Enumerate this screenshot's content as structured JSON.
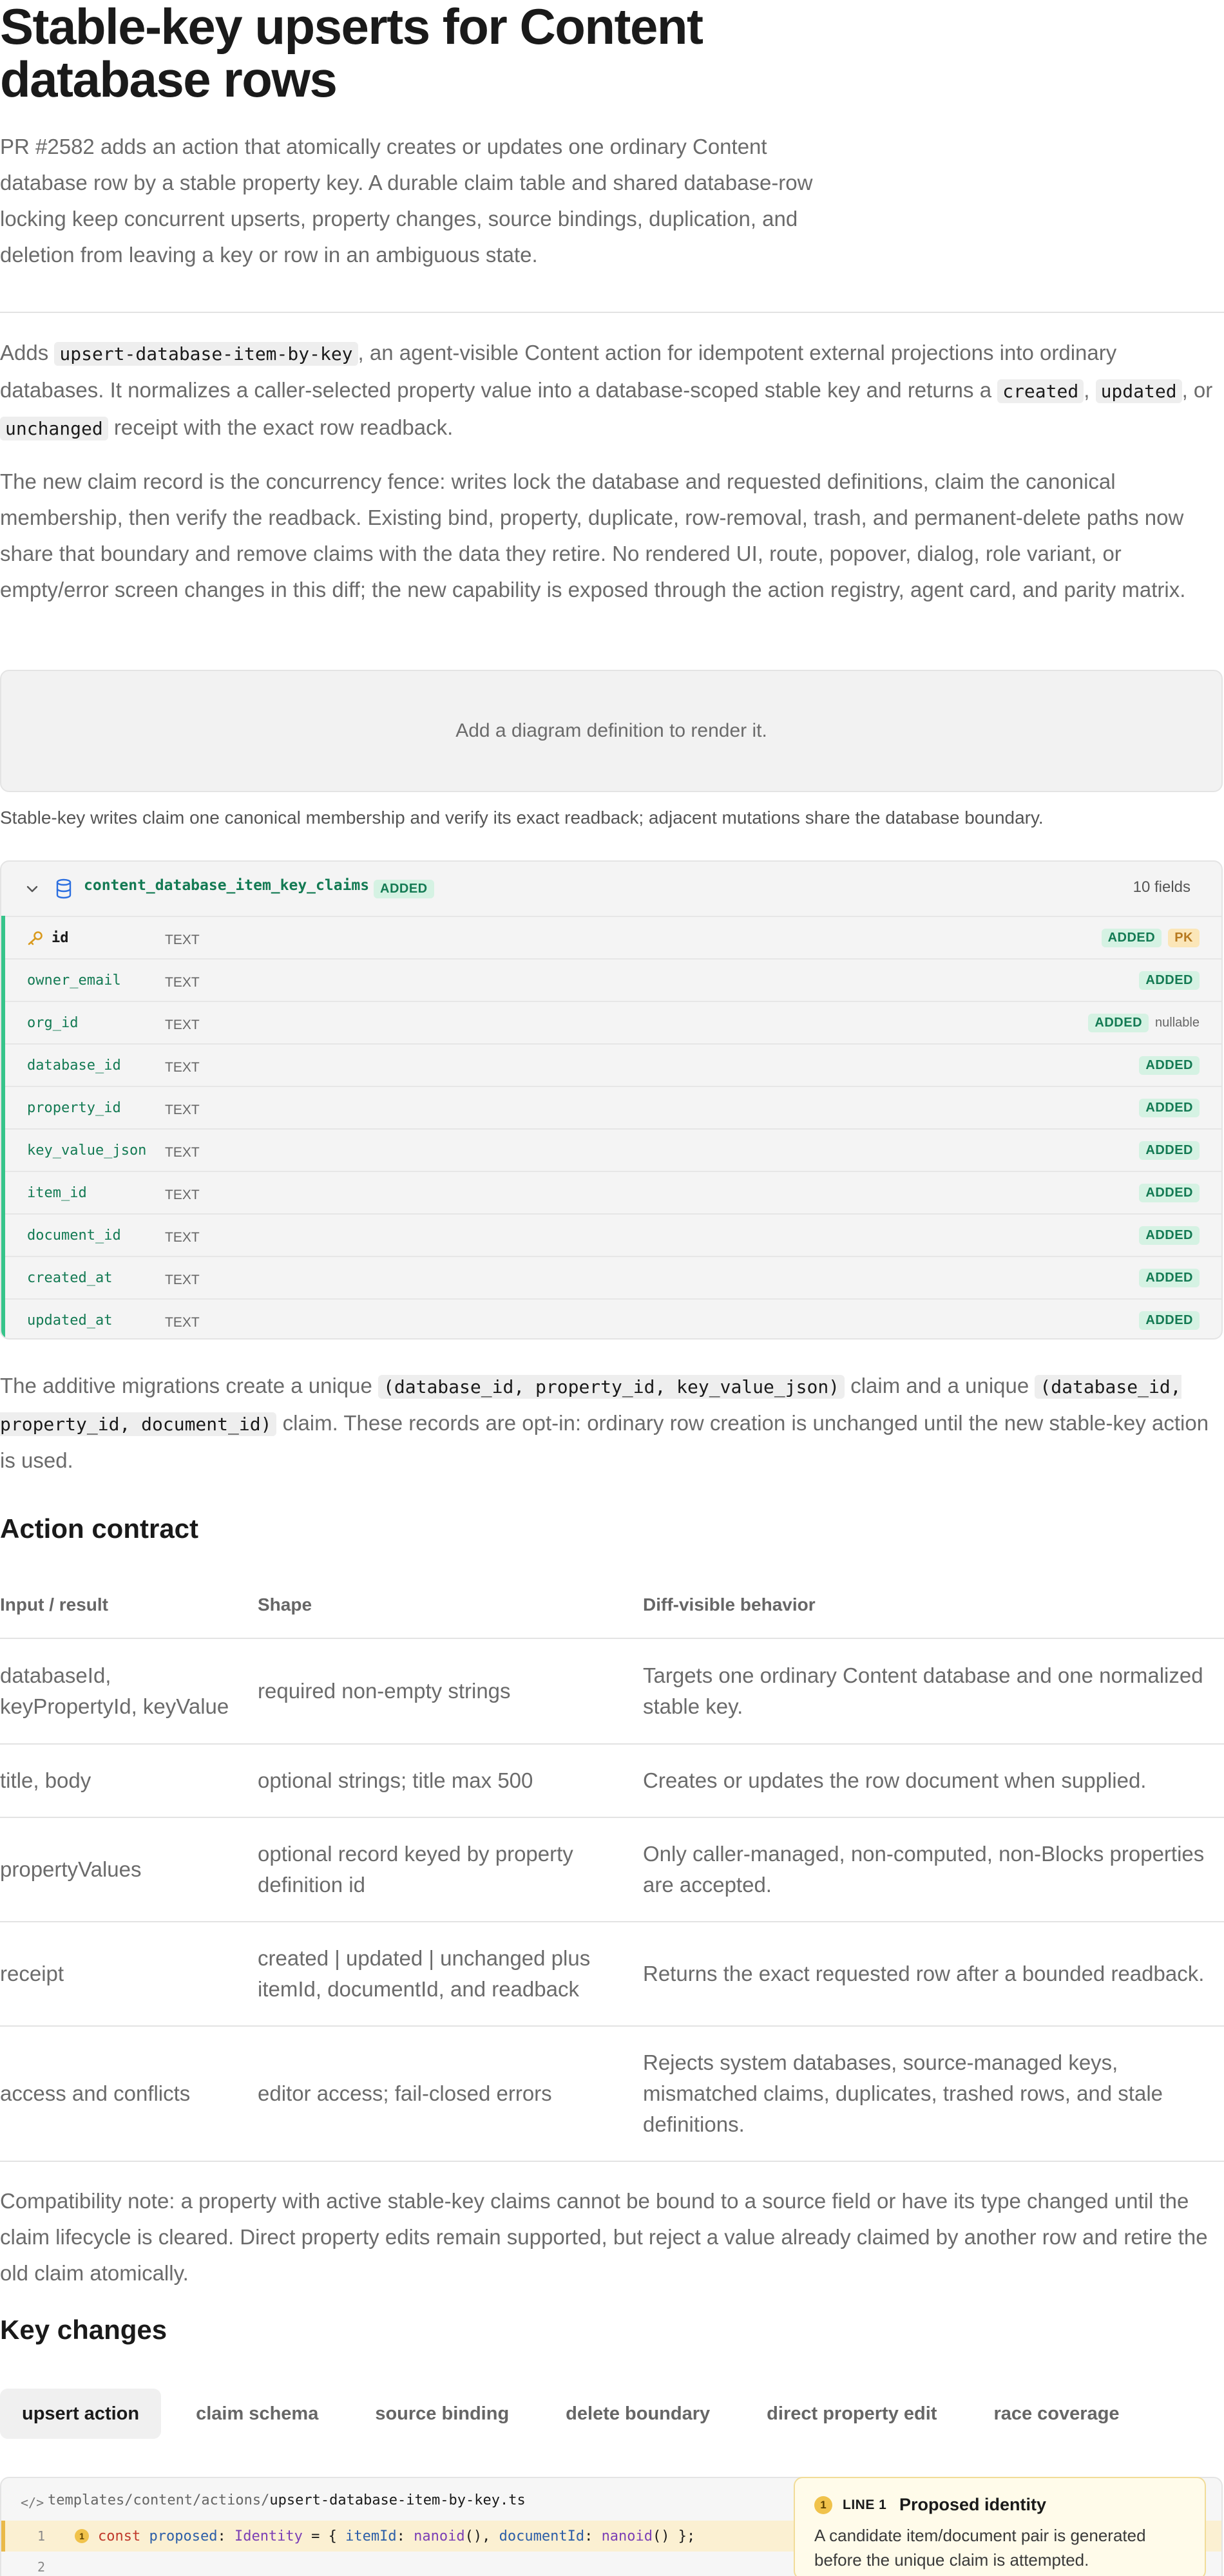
{
  "title": "Stable-key upserts for Content database rows",
  "lede": "PR #2582 adds an action that atomically creates or updates one ordinary Content database row by a stable property key. A durable claim table and shared database-row locking keep concurrent upserts, property changes, source bindings, duplication, and deletion from leaving a key or row in an ambiguous state.",
  "intro": {
    "p1_a": "Adds ",
    "p1_code1": "upsert-database-item-by-key",
    "p1_b": ", an agent-visible Content action for idempotent external projections into ordinary databases. It normalizes a caller-selected property value into a database-scoped stable key and returns a ",
    "p1_code2": "created",
    "p1_c": ", ",
    "p1_code3": "updated",
    "p1_d": ", or ",
    "p1_code4": "unchanged",
    "p1_e": " receipt with the exact row readback.",
    "p2": "The new claim record is the concurrency fence: writes lock the database and requested definitions, claim the canonical membership, then verify the readback. Existing bind, property, duplicate, row-removal, trash, and permanent-delete paths now share that boundary and remove claims with the data they retire. No rendered UI, route, popover, dialog, role variant, or empty/error screen changes in this diff; the new capability is exposed through the action registry, agent card, and parity matrix."
  },
  "diagram": {
    "placeholder": "Add a diagram definition to render it.",
    "caption": "Stable-key writes claim one canonical membership and verify its exact readback; adjacent mutations share the database boundary."
  },
  "schema": {
    "table_name": "content_database_item_key_claims",
    "status": "ADDED",
    "field_count": "10 fields",
    "fields": [
      {
        "name": "id",
        "type": "TEXT",
        "badges": [
          "ADDED",
          "PK"
        ],
        "note": ""
      },
      {
        "name": "owner_email",
        "type": "TEXT",
        "badges": [
          "ADDED"
        ],
        "note": ""
      },
      {
        "name": "org_id",
        "type": "TEXT",
        "badges": [
          "ADDED"
        ],
        "note": "nullable"
      },
      {
        "name": "database_id",
        "type": "TEXT",
        "badges": [
          "ADDED"
        ],
        "note": ""
      },
      {
        "name": "property_id",
        "type": "TEXT",
        "badges": [
          "ADDED"
        ],
        "note": ""
      },
      {
        "name": "key_value_json",
        "type": "TEXT",
        "badges": [
          "ADDED"
        ],
        "note": ""
      },
      {
        "name": "item_id",
        "type": "TEXT",
        "badges": [
          "ADDED"
        ],
        "note": ""
      },
      {
        "name": "document_id",
        "type": "TEXT",
        "badges": [
          "ADDED"
        ],
        "note": ""
      },
      {
        "name": "created_at",
        "type": "TEXT",
        "badges": [
          "ADDED"
        ],
        "note": ""
      },
      {
        "name": "updated_at",
        "type": "TEXT",
        "badges": [
          "ADDED"
        ],
        "note": ""
      }
    ]
  },
  "migration": {
    "a": "The additive migrations create a unique ",
    "code1": "(database_id, property_id, key_value_json)",
    "b": " claim and a unique ",
    "code2": "(database_id, property_id, document_id)",
    "c": " claim. These records are opt-in: ordinary row creation is unchanged until the new stable-key action is used."
  },
  "contract": {
    "heading": "Action contract",
    "headers": [
      "Input / result",
      "Shape",
      "Diff-visible behavior"
    ],
    "rows": [
      [
        "databaseId, keyPropertyId, keyValue",
        "required non-empty strings",
        "Targets one ordinary Content database and one normalized stable key."
      ],
      [
        "title, body",
        "optional strings; title max 500",
        "Creates or updates the row document when supplied."
      ],
      [
        "propertyValues",
        "optional record keyed by property definition id",
        "Only caller-managed, non-computed, non-Blocks properties are accepted."
      ],
      [
        "receipt",
        "created | updated | unchanged plus itemId, documentId, and readback",
        "Returns the exact requested row after a bounded readback."
      ],
      [
        "access and conflicts",
        "editor access; fail-closed errors",
        "Rejects system databases, source-managed keys, mismatched claims, duplicates, trashed rows, and stale definitions."
      ]
    ]
  },
  "compat_note": "Compatibility note: a property with active stable-key claims cannot be bound to a source field or have its type changed until the claim lifecycle is cleared. Direct property edits remain supported, but reject a value already claimed by another row and retire the old claim atomically.",
  "key_changes": {
    "heading": "Key changes",
    "tabs": [
      "upsert action",
      "claim schema",
      "source binding",
      "delete boundary",
      "direct property edit",
      "race coverage"
    ],
    "active_tab": 0
  },
  "code": {
    "path_prefix": "templates/content/actions/",
    "path_file": "upsert-database-item-by-key.ts",
    "line1_no": "1",
    "line2_no": "2",
    "marker": "1",
    "tok_const": "const",
    "tok_var": "proposed",
    "tok_colon": ": ",
    "tok_type": "Identity",
    "tok_eq": " = { ",
    "tok_k1": "itemId",
    "tok_sep1": ": ",
    "tok_f1": "nanoid",
    "tok_p1": "(), ",
    "tok_k2": "documentId",
    "tok_sep2": ": ",
    "tok_f2": "nanoid",
    "tok_end": "() };"
  },
  "callout": {
    "number": "1",
    "line_label": "LINE 1",
    "title": "Proposed identity",
    "body": "A candidate item/document pair is generated before the unique claim is attempted."
  },
  "colors": {
    "accent_green": "#137a53",
    "added_badge_bg": "#d5f2e3",
    "pk_badge_bg": "#fbe6b8",
    "highlight_line": "#fbf0d2"
  }
}
